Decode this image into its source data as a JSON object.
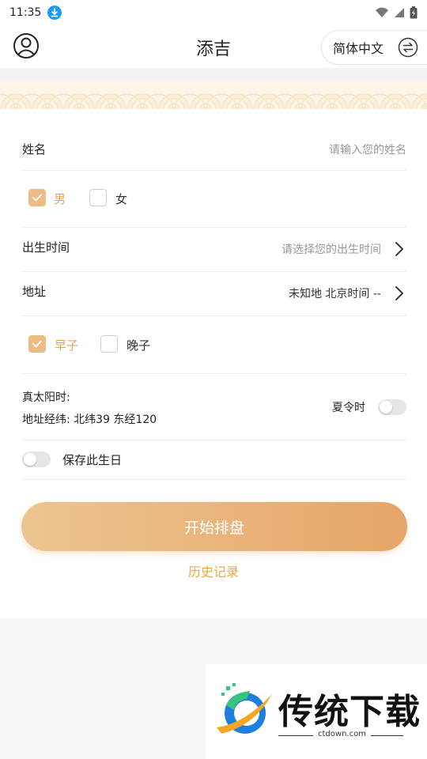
{
  "status_bar": {
    "time": "11:35"
  },
  "header": {
    "title": "添吉",
    "language": "简体中文"
  },
  "form": {
    "name": {
      "label": "姓名",
      "placeholder": "请输入您的姓名"
    },
    "gender": {
      "male": "男",
      "female": "女",
      "selected": "男"
    },
    "birth_time": {
      "label": "出生时间",
      "placeholder": "请选择您的出生时间"
    },
    "address": {
      "label": "地址",
      "value": "未知地 北京时间 --"
    },
    "zi_hour": {
      "early": "早子",
      "late": "晚子",
      "selected": "早子"
    },
    "solar": {
      "label": "真太阳时:",
      "coords": "地址经纬: 北纬39 东经120",
      "dst_label": "夏令时",
      "dst_on": false
    },
    "save": {
      "label": "保存此生日",
      "on": false
    }
  },
  "actions": {
    "start": "开始排盘",
    "history": "历史记录"
  },
  "ad": {
    "name": "传统下载",
    "url": "ctdown.com"
  },
  "colors": {
    "accent": "#e8a54f",
    "button_start": "#ecc591",
    "button_end": "#e6a567",
    "checkbox": "#ebbd84"
  }
}
